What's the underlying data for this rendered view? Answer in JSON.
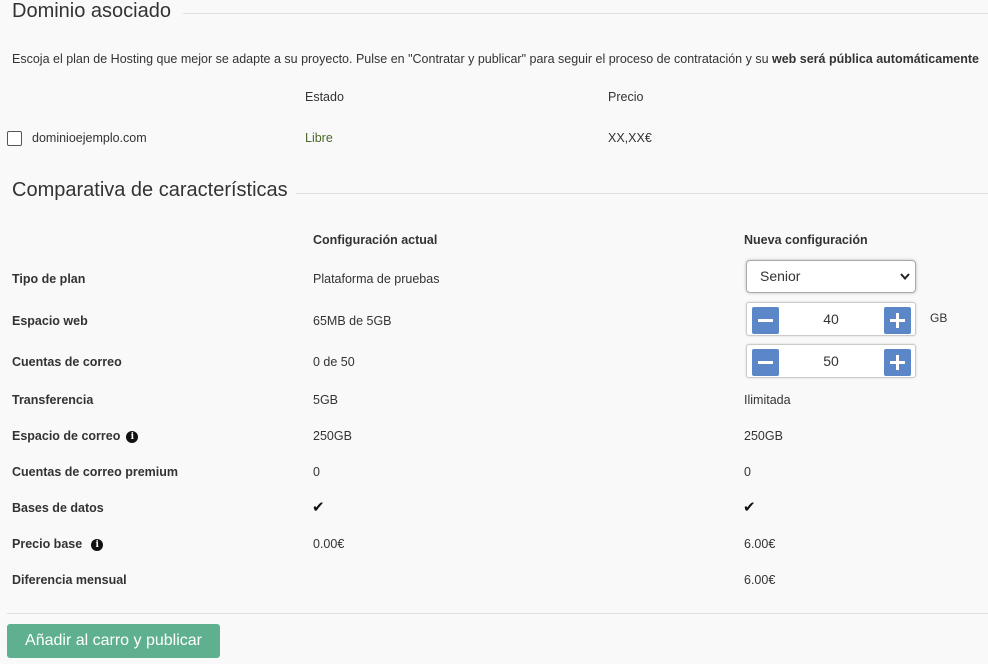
{
  "domain_section": {
    "title": "Dominio asociado",
    "intro_text": "Escoja el plan de Hosting que mejor se adapte a su proyecto. Pulse en \"Contratar y publicar\" para seguir el proceso de contratación y su ",
    "intro_bold": "web será pública automáticamente",
    "col_status": "Estado",
    "col_price": "Precio",
    "domain": {
      "name": "dominioejemplo.com",
      "status": "Libre",
      "price": "XX,XX€",
      "checked": false
    }
  },
  "comparison": {
    "title": "Comparativa de características",
    "col_current": "Configuración actual",
    "col_new": "Nueva configuración",
    "rows": [
      {
        "label": "Tipo de plan",
        "current": "Plataforma de pruebas",
        "new": "Senior"
      },
      {
        "label": "Espacio web",
        "current": "65MB de 5GB",
        "new": "40",
        "unit": "GB"
      },
      {
        "label": "Cuentas de correo",
        "current": "0 de 50",
        "new": "50"
      },
      {
        "label": "Transferencia",
        "current": "5GB",
        "new": "Ilimitada"
      },
      {
        "label": "Espacio de correo",
        "current": "250GB",
        "new": "250GB"
      },
      {
        "label": "Cuentas de correo premium",
        "current": "0",
        "new": "0"
      },
      {
        "label": "Bases de datos",
        "current": "✔",
        "new": "✔"
      },
      {
        "label": "Precio base",
        "current": "0.00€",
        "new": "6.00€"
      },
      {
        "label": "Diferencia mensual",
        "current": "",
        "new": "6.00€"
      }
    ],
    "select_icon": "chevron-down-icon",
    "info_icon": "info-icon"
  },
  "actions": {
    "submit_label": "Añadir al carro y publicar"
  },
  "colors": {
    "accent_blue": "#5b87c9",
    "button_green": "#5fb08e",
    "status_green": "#4a6a2a"
  }
}
